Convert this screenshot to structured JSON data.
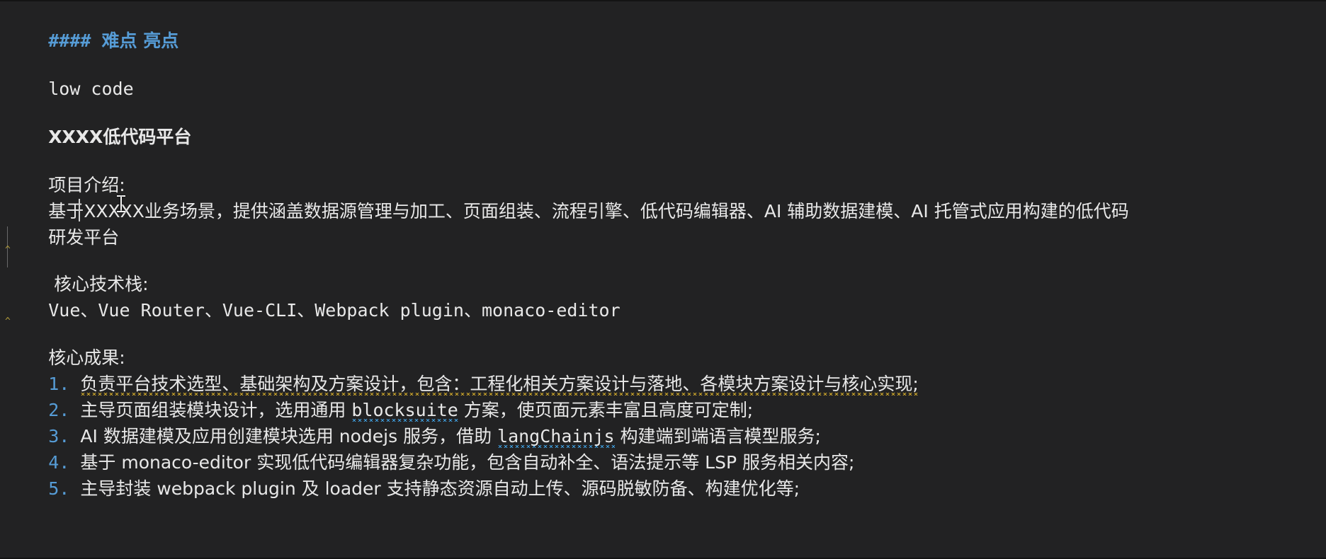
{
  "editor": {
    "app": "code-editor",
    "language": "markdown",
    "background_color": "#222223",
    "foreground_color": "#d4d4d4",
    "accent_blue": "#569cd6",
    "squiggle_warning_color": "#c8a32a",
    "squiggle_info_color": "#3e9ad8",
    "caret_color": "#cfcfcf"
  },
  "document": {
    "heading": {
      "marker": "####",
      "text": "难点 亮点"
    },
    "lines": {
      "low_code": "low code",
      "platform_title": "XXXX低代码平台",
      "intro_label": "项目介绍:",
      "intro_body_part1": "基于XXXXX业务场景，提供涵盖数据源管理与加工、页面组装、",
      "intro_body_part2": "流程引擎、低代码编辑器、AI 辅助数据建模、AI 托管式应用构建的低代码",
      "intro_body_wrap": "研发平台",
      "stack_label": " 核心技术栈:",
      "stack_body": "Vue、Vue Router、Vue-CLI、Webpack plugin、monaco-editor",
      "results_label": "核心成果:"
    },
    "results": [
      {
        "number": "1.",
        "text": "负责平台技术选型、基础架构及方案设计，包含：工程化相关方案设计与落地、各模块方案设计与核心实现;",
        "squiggle": "yellow"
      },
      {
        "number": "2.",
        "text_before": "主导页面组装模块设计，选用通用 ",
        "highlight": "blocksuite",
        "text_after": " 方案，使页面元素丰富且高度可定制;",
        "squiggle": "blue"
      },
      {
        "number": "3.",
        "text_before": "AI 数据建模及应用创建模块选用 nodejs 服务，借助 ",
        "highlight": "langChainjs",
        "text_after": " 构建端到端语言模型服务;",
        "squiggle": "blue"
      },
      {
        "number": "4.",
        "text": "基于 monaco-editor 实现低代码编辑器复杂功能，包含自动补全、语法提示等 LSP 服务相关内容;",
        "squiggle": "none"
      },
      {
        "number": "5.",
        "text": "主导封装 webpack plugin 及 loader 支持静态资源自动上传、源码脱敏防备、构建优化等;",
        "squiggle": "none"
      }
    ]
  },
  "cursor": {
    "caret_label": "text-caret",
    "pointer_label": "i-beam-pointer"
  }
}
